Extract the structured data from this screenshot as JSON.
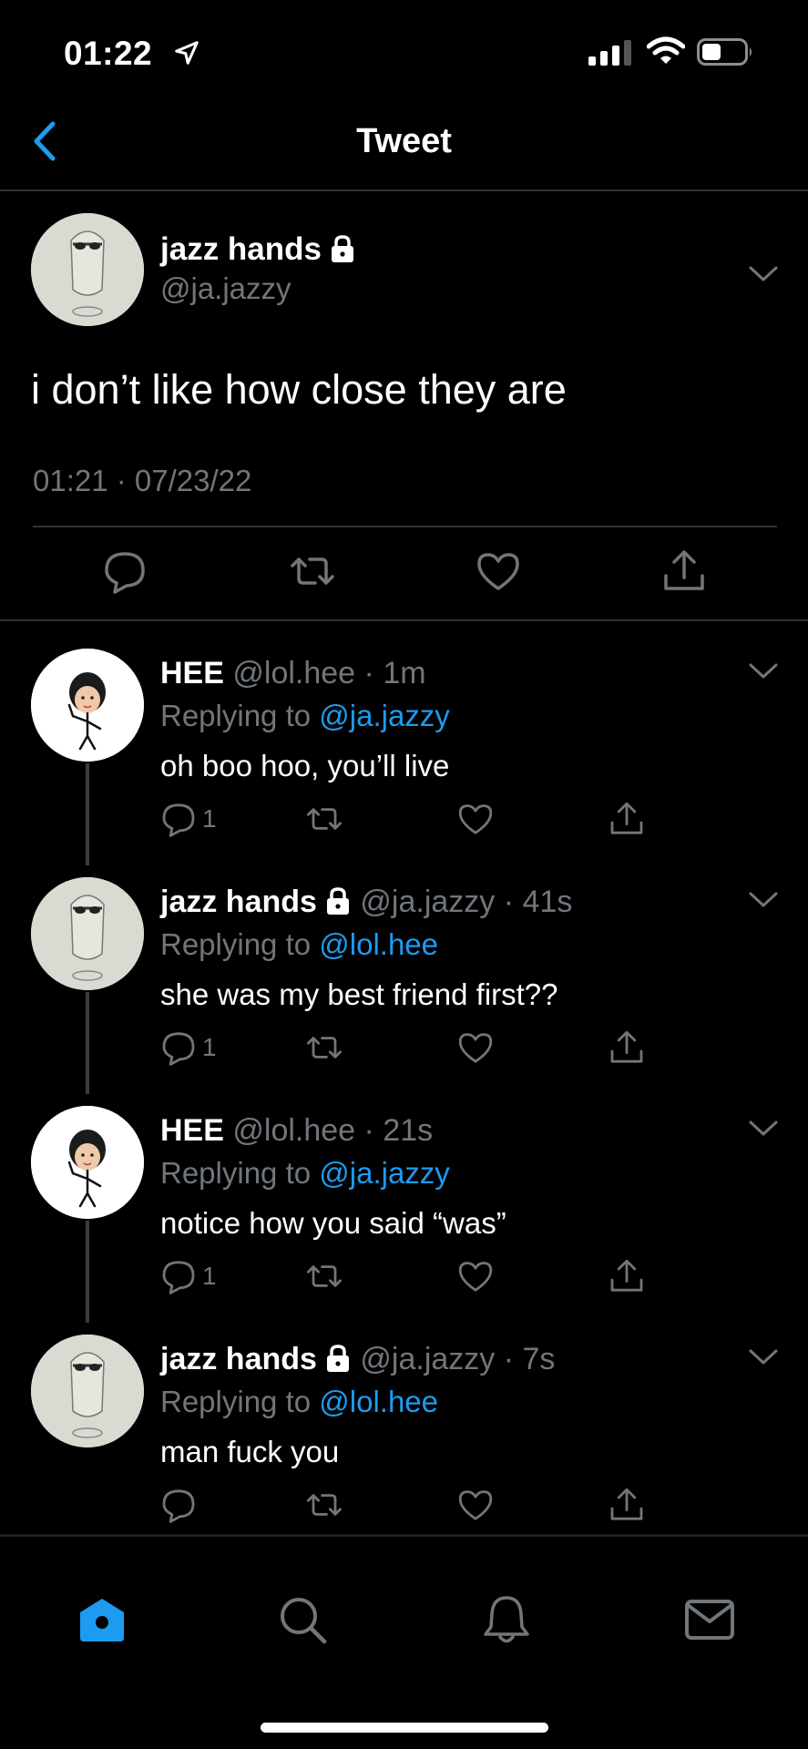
{
  "status_bar": {
    "time": "01:22"
  },
  "nav": {
    "title": "Tweet"
  },
  "main_tweet": {
    "name": "jazz hands",
    "handle": "@ja.jazzy",
    "text": "i don’t like how close they are",
    "timestamp": "01:21 · 07/23/22"
  },
  "replies": [
    {
      "name": "HEE",
      "handle": "@lol.hee",
      "dot": "·",
      "time": "1m",
      "replying_prefix": "Replying to ",
      "replying_to": "@ja.jazzy",
      "text": "oh boo hoo, you’ll live",
      "reply_count": "1",
      "locked": false
    },
    {
      "name": "jazz hands",
      "handle": "@ja.jazzy",
      "dot": "·",
      "time": "41s",
      "replying_prefix": "Replying to ",
      "replying_to": "@lol.hee",
      "text": "she was my best friend first??",
      "reply_count": "1",
      "locked": true
    },
    {
      "name": "HEE",
      "handle": "@lol.hee",
      "dot": "·",
      "time": "21s",
      "replying_prefix": "Replying to ",
      "replying_to": "@ja.jazzy",
      "text": "notice how you said “was”",
      "reply_count": "1",
      "locked": false
    },
    {
      "name": "jazz hands",
      "handle": "@ja.jazzy",
      "dot": "·",
      "time": "7s",
      "replying_prefix": "Replying to ",
      "replying_to": "@lol.hee",
      "text": "man fuck you",
      "reply_count": "",
      "locked": true
    }
  ],
  "tabs": [
    {
      "icon": "home-icon",
      "active": true
    },
    {
      "icon": "search-icon",
      "active": false
    },
    {
      "icon": "bell-icon",
      "active": false
    },
    {
      "icon": "mail-icon",
      "active": false
    }
  ],
  "colors": {
    "background": "#000000",
    "accent": "#1d9bf0",
    "secondary_text": "#71767b",
    "divider": "#2f3336"
  }
}
